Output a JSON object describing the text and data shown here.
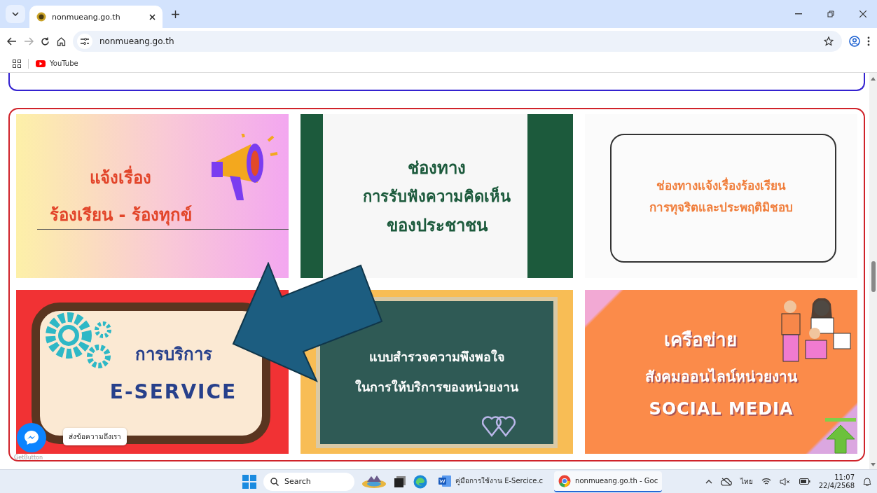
{
  "browser": {
    "tabs": [
      {
        "title": "nonmueang.go.th",
        "selected": true
      }
    ],
    "url": "nonmueang.go.th",
    "bookmarks": [
      {
        "label": "YouTube"
      }
    ]
  },
  "banners": [
    {
      "kind": "complaint",
      "lines": [
        "แจ้งเรื่อง",
        "ร้องเรียน - ร้องทุกข์"
      ]
    },
    {
      "kind": "opinion",
      "lines": [
        "ช่องทาง",
        "การรับฟังความคิดเห็น",
        "ของประชาชน"
      ]
    },
    {
      "kind": "corruption",
      "lines": [
        "ช่องทางแจ้งเรื่องร้องเรียน",
        "การทุจริตและประพฤติมิชอบ"
      ]
    },
    {
      "kind": "eservice",
      "lines": [
        "การบริการ",
        "E-SERVICE"
      ]
    },
    {
      "kind": "survey",
      "lines": [
        "แบบสำรวจความพึงพอใจ",
        "ในการให้บริการของหน่วยงาน"
      ]
    },
    {
      "kind": "social",
      "lines": [
        "เครือข่าย",
        "สังคมออนไลน์หน่วยงาน",
        "SOCIAL MEDIA"
      ]
    }
  ],
  "chat": {
    "tooltip": "ส่งข้อความถึงเรา",
    "credit": "GetButton"
  },
  "taskbar": {
    "search": "Search",
    "apps": [
      {
        "kind": "word",
        "label": "คู่มือการใช้งาน E-Sercice.c",
        "selected": false
      },
      {
        "kind": "chrome",
        "label": "nonmueang.go.th - Goc",
        "selected": true
      }
    ],
    "language": "ไทย",
    "time": "11:07",
    "date": "22/4/2568"
  }
}
